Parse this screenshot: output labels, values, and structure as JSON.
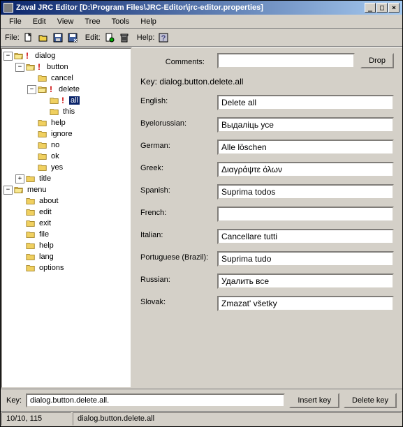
{
  "title": "Zaval JRC Editor [D:\\Program Files\\JRC-Editor\\jrc-editor.properties]",
  "win_btns": {
    "min": "_",
    "max": "□",
    "close": "×"
  },
  "menu": {
    "file": "File",
    "edit": "Edit",
    "view": "View",
    "tree": "Tree",
    "tools": "Tools",
    "help": "Help"
  },
  "toolbar": {
    "file_label": "File:",
    "edit_label": "Edit:",
    "help_label": "Help:"
  },
  "tree": {
    "dialog": "dialog",
    "button": "button",
    "cancel": "cancel",
    "delete": "delete",
    "all": "all",
    "this": "this",
    "help": "help",
    "ignore": "ignore",
    "no": "no",
    "ok": "ok",
    "yes": "yes",
    "title": "title",
    "menu": "menu",
    "about": "about",
    "edit_n": "edit",
    "exit": "exit",
    "file_n": "file",
    "help_n": "help",
    "lang": "lang",
    "options": "options"
  },
  "form": {
    "comments_label": "Comments:",
    "comments_value": "",
    "drop": "Drop",
    "key_label": "Key: dialog.button.delete.all",
    "langs": {
      "english": {
        "label": "English:",
        "value": "Delete all"
      },
      "byelorussian": {
        "label": "Byelorussian:",
        "value": "Выдаліць усе"
      },
      "german": {
        "label": "German:",
        "value": "Alle löschen"
      },
      "greek": {
        "label": "Greek:",
        "value": "Διαγράψτε όλων"
      },
      "spanish": {
        "label": "Spanish:",
        "value": "Suprima todos"
      },
      "french": {
        "label": "French:",
        "value": ""
      },
      "italian": {
        "label": "Italian:",
        "value": "Cancellare tutti"
      },
      "portuguese": {
        "label": "Portuguese (Brazil):",
        "value": "Suprima tudo"
      },
      "russian": {
        "label": "Russian:",
        "value": "Удалить все"
      },
      "slovak": {
        "label": "Slovak:",
        "value": "Zmazat' všetky"
      }
    }
  },
  "bottom": {
    "key_label": "Key:",
    "key_value": "dialog.button.delete.all.",
    "insert": "Insert key",
    "delete": "Delete key"
  },
  "status": {
    "pos": "10/10, 115",
    "path": "dialog.button.delete.all"
  }
}
